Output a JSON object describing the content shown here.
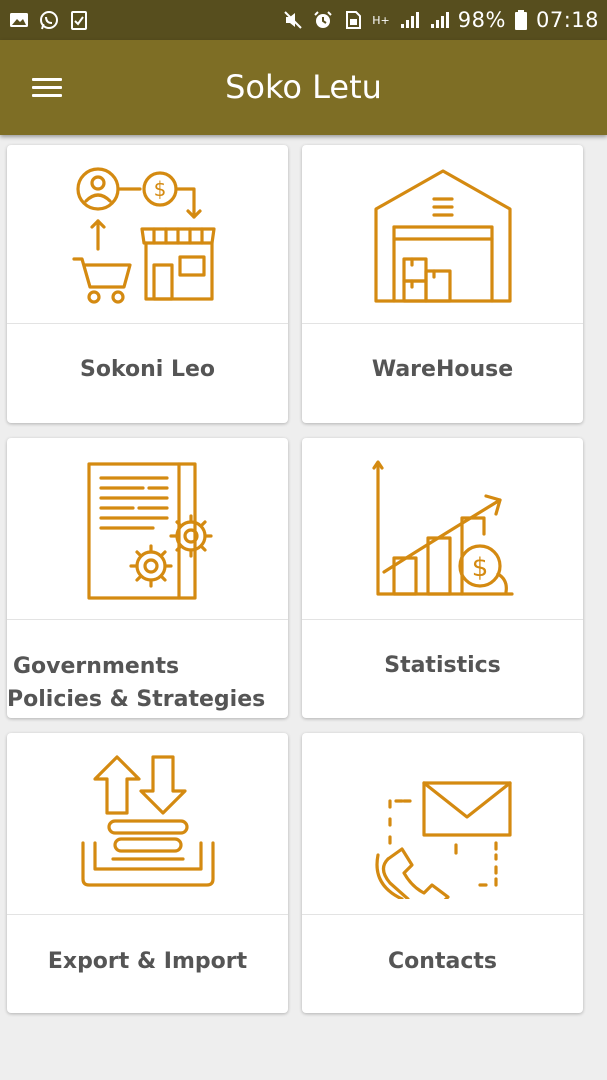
{
  "status_bar": {
    "battery": "98%",
    "time": "07:18",
    "network": "H+",
    "left_icons": [
      "image-icon",
      "whatsapp-icon",
      "checklist-icon"
    ],
    "right_icons": [
      "mute-icon",
      "alarm-icon",
      "sim-icon",
      "signal-icon",
      "signal-icon",
      "battery-icon"
    ]
  },
  "appbar": {
    "title": "Soko Letu",
    "menu_icon": "hamburger-menu-icon"
  },
  "theme": {
    "appbar_color": "#7e6e25",
    "statusbar_color": "#574e1e",
    "icon_color": "#d48a11",
    "label_color": "#555555"
  },
  "cards": [
    {
      "label": "Sokoni Leo",
      "icon": "market-icon"
    },
    {
      "label": "WareHouse",
      "icon": "warehouse-icon"
    },
    {
      "label_line1": "Governments",
      "label_line2": "Policies & Strategies",
      "icon": "policy-document-icon"
    },
    {
      "label": "Statistics",
      "icon": "statistics-icon"
    },
    {
      "label": "Export & Import",
      "icon": "export-import-icon"
    },
    {
      "label": "Contacts",
      "icon": "contacts-icon"
    }
  ]
}
